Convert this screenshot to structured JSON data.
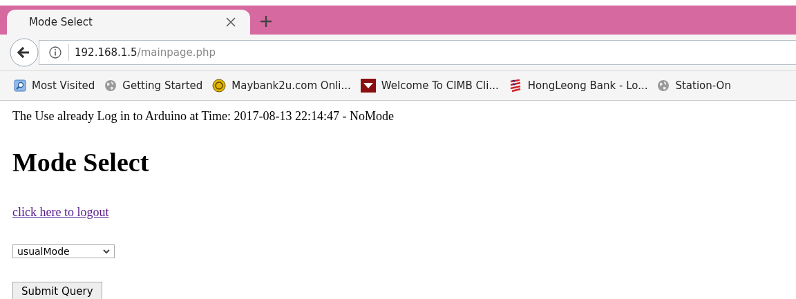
{
  "tabs": [
    {
      "label": "Mode Select",
      "selected": true
    }
  ],
  "address_bar": {
    "host": "192.168.1.5",
    "path": "/mainpage.php"
  },
  "bookmarks": [
    {
      "label": "Most Visited",
      "kind": "folder"
    },
    {
      "label": "Getting Started",
      "kind": "globe"
    },
    {
      "label": "Maybank2u.com Onli...",
      "kind": "coin"
    },
    {
      "label": "Welcome To CIMB Cli...",
      "kind": "flag"
    },
    {
      "label": "HongLeong Bank - Lo...",
      "kind": "stripes"
    },
    {
      "label": "Station-On",
      "kind": "globe"
    }
  ],
  "page": {
    "status_text": "The Use already Log in to Arduino at Time: 2017-08-13 22:14:47 - NoMode",
    "heading": "Mode Select",
    "logout_link": "click here to logout",
    "mode_select": {
      "value": "usualMode"
    },
    "submit_button": "Submit Query"
  }
}
